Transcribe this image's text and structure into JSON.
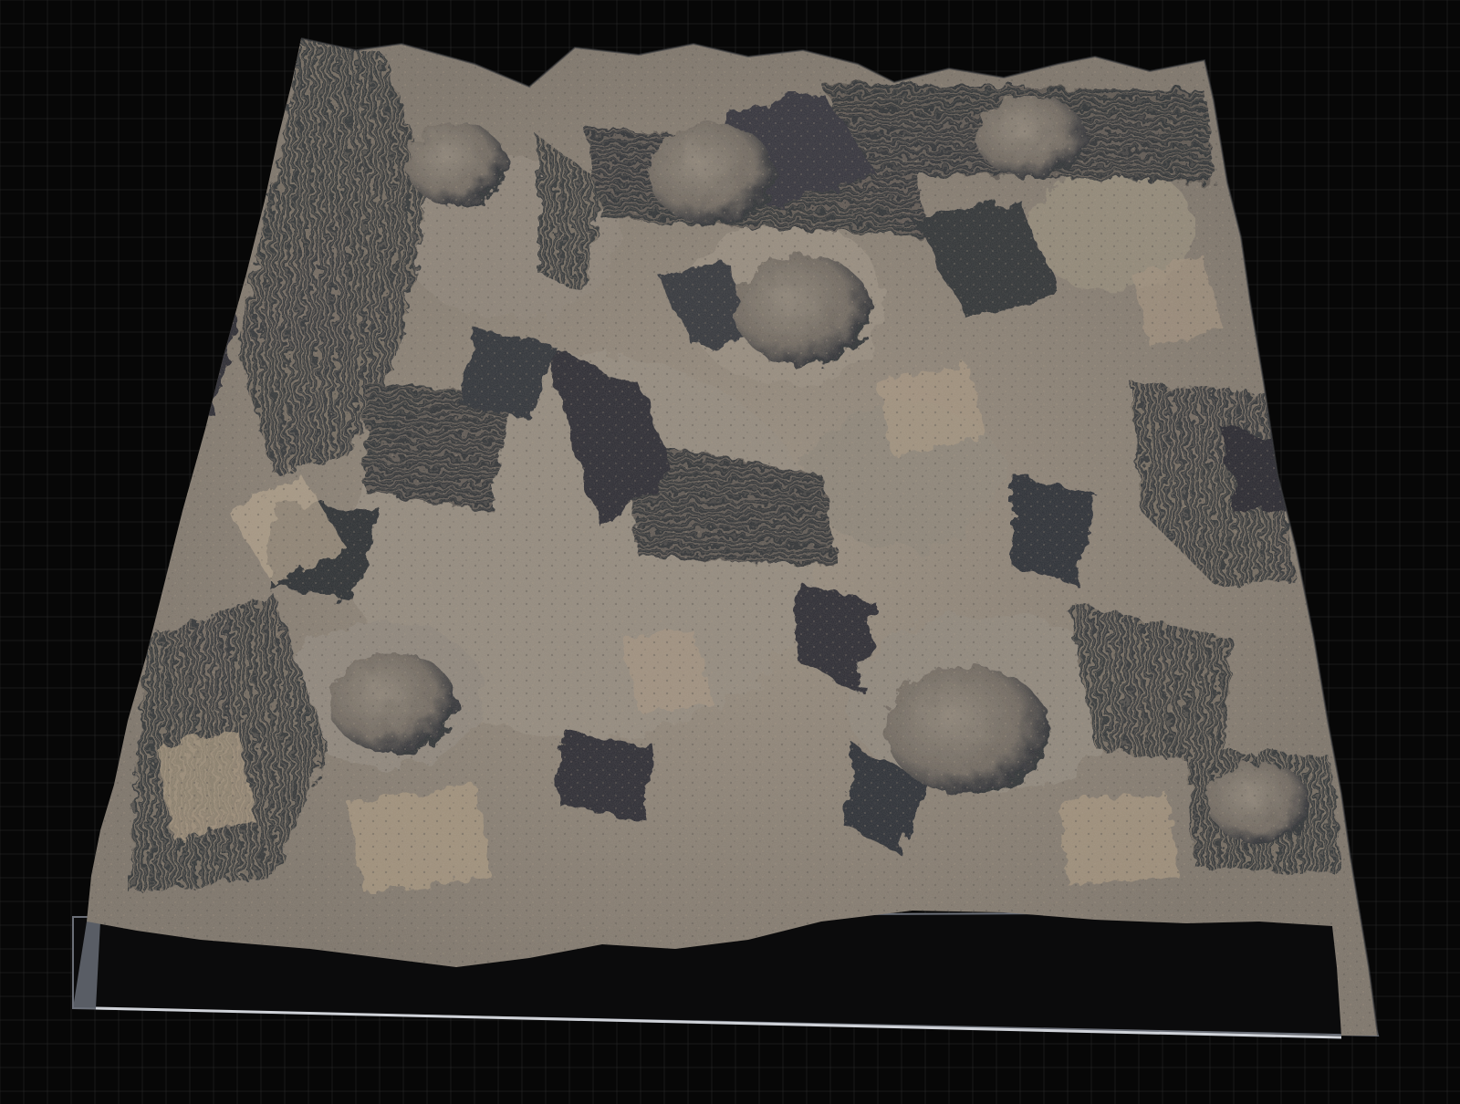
{
  "viewport": {
    "background_color": "#070707",
    "grid_color": "#2a2a2a",
    "grid_major_color": "#3a3a3a"
  },
  "terrain": {
    "type": "procedural-heightfield",
    "colors": {
      "flat_lit": "#8c8378",
      "highlight": "#b4a48e",
      "mid": "#5e5a55",
      "shadow": "#2c2e34",
      "deep_shadow": "#17191e",
      "plane": "#8a8580",
      "plane_edge": "#7a7f8a"
    }
  }
}
